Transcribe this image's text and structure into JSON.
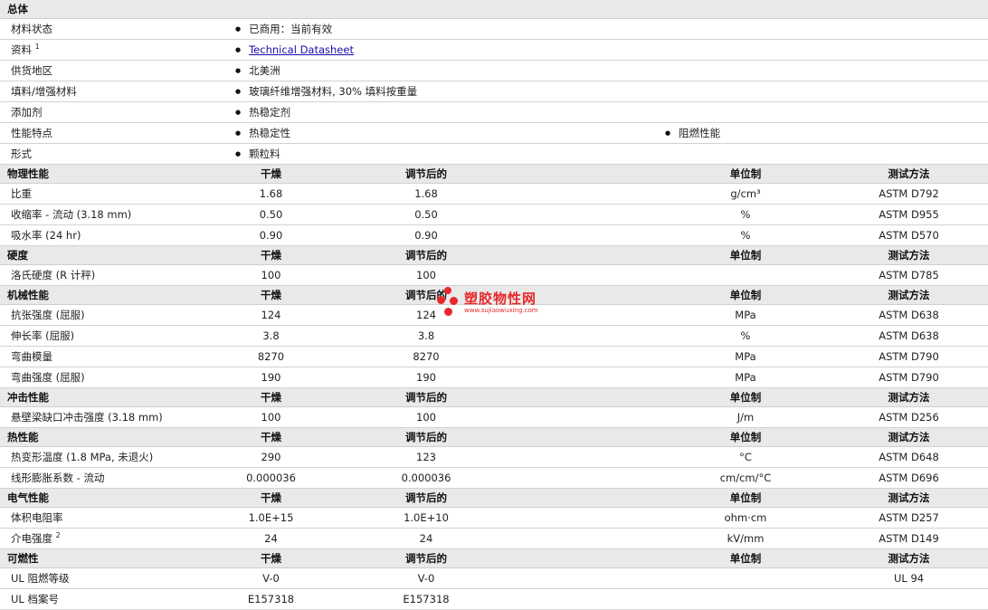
{
  "general": {
    "title": "总体",
    "rows": [
      {
        "label": "材料状态",
        "items": [
          "已商用：当前有效"
        ]
      },
      {
        "label": "资料",
        "sup": "1",
        "items": [
          "Technical Datasheet"
        ],
        "link": true
      },
      {
        "label": "供货地区",
        "items": [
          "北美洲"
        ]
      },
      {
        "label": "填料/增强材料",
        "items": [
          "玻璃纤维增强材料, 30% 填料按重量"
        ]
      },
      {
        "label": "添加剂",
        "items": [
          "热稳定剂"
        ]
      },
      {
        "label": "性能特点",
        "items": [
          "热稳定性",
          "阻燃性能"
        ]
      },
      {
        "label": "形式",
        "items": [
          "颗粒料"
        ]
      }
    ]
  },
  "col_headers": {
    "dry": "干燥",
    "cond": "调节后的",
    "unit": "单位制",
    "method": "测试方法"
  },
  "sections": [
    {
      "title": "物理性能",
      "rows": [
        {
          "label": "比重",
          "dry": "1.68",
          "cond": "1.68",
          "unit": "g/cm³",
          "method": "ASTM D792"
        },
        {
          "label": "收缩率 - 流动 (3.18 mm)",
          "dry": "0.50",
          "cond": "0.50",
          "unit": "%",
          "method": "ASTM D955"
        },
        {
          "label": "吸水率 (24 hr)",
          "dry": "0.90",
          "cond": "0.90",
          "unit": "%",
          "method": "ASTM D570"
        }
      ]
    },
    {
      "title": "硬度",
      "rows": [
        {
          "label": "洛氏硬度 (R 计秤)",
          "dry": "100",
          "cond": "100",
          "unit": "",
          "method": "ASTM D785"
        }
      ]
    },
    {
      "title": "机械性能",
      "rows": [
        {
          "label": "抗张强度 (屈服)",
          "dry": "124",
          "cond": "124",
          "unit": "MPa",
          "method": "ASTM D638"
        },
        {
          "label": "伸长率 (屈服)",
          "dry": "3.8",
          "cond": "3.8",
          "unit": "%",
          "method": "ASTM D638"
        },
        {
          "label": "弯曲模量",
          "dry": "8270",
          "cond": "8270",
          "unit": "MPa",
          "method": "ASTM D790"
        },
        {
          "label": "弯曲强度 (屈服)",
          "dry": "190",
          "cond": "190",
          "unit": "MPa",
          "method": "ASTM D790"
        }
      ]
    },
    {
      "title": "冲击性能",
      "rows": [
        {
          "label": "悬壁梁缺口冲击强度 (3.18 mm)",
          "dry": "100",
          "cond": "100",
          "unit": "J/m",
          "method": "ASTM D256"
        }
      ]
    },
    {
      "title": "热性能",
      "rows": [
        {
          "label": "热变形温度 (1.8 MPa, 未退火)",
          "dry": "290",
          "cond": "123",
          "unit": "°C",
          "method": "ASTM D648"
        },
        {
          "label": "线形膨胀系数 - 流动",
          "dry": "0.000036",
          "cond": "0.000036",
          "unit": "cm/cm/°C",
          "method": "ASTM D696"
        }
      ]
    },
    {
      "title": "电气性能",
      "rows": [
        {
          "label": "体积电阻率",
          "dry": "1.0E+15",
          "cond": "1.0E+10",
          "unit": "ohm·cm",
          "method": "ASTM D257"
        },
        {
          "label": "介电强度",
          "sup": "2",
          "dry": "24",
          "cond": "24",
          "unit": "kV/mm",
          "method": "ASTM D149"
        }
      ]
    },
    {
      "title": "可燃性",
      "rows": [
        {
          "label": "UL 阻燃等级",
          "dry": "V-0",
          "cond": "V-0",
          "unit": "",
          "method": "UL 94"
        },
        {
          "label": "UL 档案号",
          "dry": "E157318",
          "cond": "E157318",
          "unit": "",
          "method": ""
        }
      ]
    }
  ],
  "watermark": {
    "title": "塑胶物性网",
    "url": "www.sujiaowuxing.com",
    "color": "#e8282c"
  }
}
